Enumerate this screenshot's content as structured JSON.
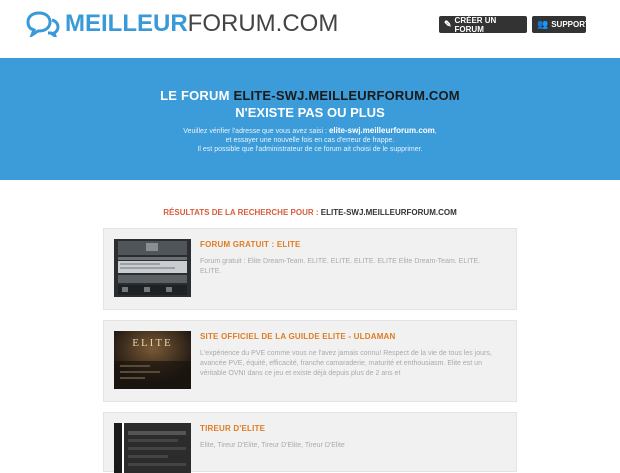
{
  "brand": {
    "part1": "MEILLEUR",
    "part2": "FORUM.COM"
  },
  "header": {
    "create_label": "CRÉER UN FORUM",
    "support_label": "SUPPORT"
  },
  "banner": {
    "title_prefix": "LE FORUM",
    "domain": "ELITE-SWJ.MEILLEURFORUM.COM",
    "title_line2": "N'EXISTE PAS OU PLUS",
    "msg_prefix": "Veuillez vérifier l'adresse que vous avez saisi :",
    "msg_domain": "elite-swj.meilleurforum.com",
    "msg_suffix": ",",
    "msg_line2": "et essayer une nouvelle fois en cas d'erreur de frappe.",
    "msg_line3": "Il est possible que l'administrateur de ce forum ait choisi de le supprimer."
  },
  "results": {
    "label": "RÉSULTATS DE LA RECHERCHE POUR :",
    "query": "ELITE-SWJ.MEILLEURFORUM.COM",
    "items": [
      {
        "title": "FORUM GRATUIT : ELITE",
        "description": "Forum gratuit : Elite Dream-Team. ELITE. ELITE. ELITE. ELITE Elite Dream-Team. ELITE. ELITE."
      },
      {
        "title": "SITE OFFICIEL DE LA GUILDE ELITE - ULDAMAN",
        "description": "L'expérience du PVE comme vous ne l'avez jamais connu! Respect de la vie de tous les jours, avancée PVE, équité, efficacité, franche camaraderie, maturité et enthousiasm. Elite est un véritable OVNI dans ce jeu et existe déjà depuis plus de 2 ans et",
        "thumb_text": "ELITE"
      },
      {
        "title": "TIREUR D'ELITE",
        "description": "Elite, Tireur D'Elite, Tireur D'Elite, Tireur D'Elite"
      }
    ]
  },
  "colors": {
    "accent": "#3c9bd9",
    "title_orange": "#e07c24",
    "label_red": "#d95c3c",
    "dark_button": "#333333"
  },
  "icons": {
    "logo": "speech-bubbles-icon",
    "create": "comment-icon",
    "support": "users-icon"
  }
}
